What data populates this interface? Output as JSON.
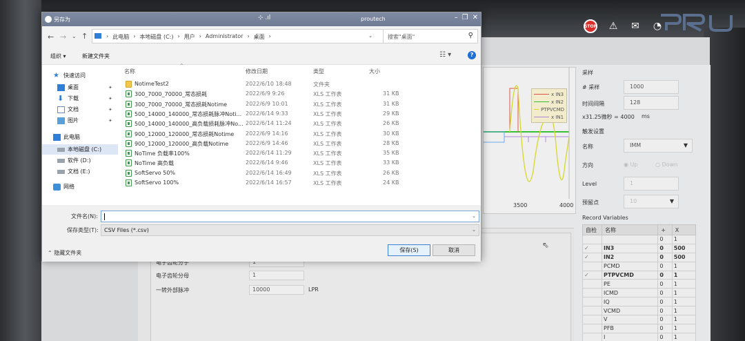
{
  "background": {
    "colors": {
      "stop": "#d9302c",
      "accent": "#1e6ed6"
    }
  },
  "app": {
    "plot": {
      "legend": [
        "x IN3",
        "x IN2",
        "PTPVCMD",
        "x IN1"
      ],
      "legend_colors": [
        "#e0504a",
        "#35c035",
        "#d8d832",
        "#b08ad8"
      ],
      "x_ticks": [
        "3500",
        "4000"
      ]
    },
    "sampling": {
      "section": "采样",
      "sample_label": "# 采样",
      "sample_value": "1000",
      "interval_label": "时间间隔",
      "interval_value": "128",
      "interval_note": "x31.25微秒 = 4000",
      "interval_unit": "ms"
    },
    "trigger": {
      "section": "触发设置",
      "name_label": "名称",
      "name_value": "IMM",
      "direction_label": "方向",
      "dir_up": "Up",
      "dir_down": "Down",
      "level_label": "Level",
      "level_value": "1",
      "pretrigger_label": "预留点",
      "pretrigger_value": "10"
    },
    "record_variables": {
      "title": "Record Variables",
      "headers": [
        "自检",
        "名称",
        "+",
        "X"
      ],
      "rows": [
        {
          "check": "",
          "name": "",
          "plus": "0",
          "x": "1",
          "style": ""
        },
        {
          "check": "✓",
          "name": "IN3",
          "plus": "0",
          "x": "500",
          "style": "rv-red"
        },
        {
          "check": "✓",
          "name": "IN2",
          "plus": "0",
          "x": "500",
          "style": "rv-green"
        },
        {
          "check": "",
          "name": "PCMD",
          "plus": "0",
          "x": "1",
          "style": ""
        },
        {
          "check": "✓",
          "name": "PTPVCMD",
          "plus": "0",
          "x": "1",
          "style": "rv-yellow"
        },
        {
          "check": "",
          "name": "PE",
          "plus": "0",
          "x": "1",
          "style": ""
        },
        {
          "check": "",
          "name": "ICMD",
          "plus": "0",
          "x": "1",
          "style": ""
        },
        {
          "check": "",
          "name": "IQ",
          "plus": "0",
          "x": "1",
          "style": ""
        },
        {
          "check": "",
          "name": "VCMD",
          "plus": "0",
          "x": "1",
          "style": ""
        },
        {
          "check": "",
          "name": "V",
          "plus": "0",
          "x": "1",
          "style": ""
        },
        {
          "check": "",
          "name": "PFB",
          "plus": "0",
          "x": "1",
          "style": ""
        },
        {
          "check": "",
          "name": "I",
          "plus": "0",
          "x": "1",
          "style": ""
        }
      ]
    },
    "gear": {
      "numerator_label": "电子齿轮分子",
      "numerator_value": "1",
      "denominator_label": "电子齿轮分母",
      "denominator_value": "1",
      "pulse_label": "一转外部脉冲",
      "pulse_value": "10000",
      "pulse_unit": "LPR"
    }
  },
  "dialog": {
    "title": "另存为",
    "center_title": "proutech",
    "address": {
      "crumbs": [
        "此电脑",
        "本地磁盘 (C:)",
        "用户",
        "Administrator",
        "桌面"
      ]
    },
    "search_placeholder": "搜索\"桌面\"",
    "toolbar": {
      "organize": "组织 ▾",
      "new_folder": "新建文件夹"
    },
    "nav": {
      "quick_access": "快速访问",
      "desktop": "桌面",
      "downloads": "下载",
      "documents": "文档",
      "pictures": "图片",
      "this_pc": "此电脑",
      "drive_c": "本地磁盘 (C:)",
      "drive_d": "软件 (D:)",
      "drive_e": "文档 (E:)",
      "network": "网络"
    },
    "columns": {
      "name": "名称",
      "date": "修改日期",
      "type": "类型",
      "size": "大小"
    },
    "files": [
      {
        "name": "NotimeTest2",
        "date": "2022/6/10 18:48",
        "type": "文件夹",
        "size": "",
        "kind": "folder"
      },
      {
        "name": "300_7000_70000_常态损耗",
        "date": "2022/6/9 9:26",
        "type": "XLS 工作表",
        "size": "31 KB",
        "kind": "xls"
      },
      {
        "name": "300_7000_70000_常态损耗Notime",
        "date": "2022/6/9 10:01",
        "type": "XLS 工作表",
        "size": "31 KB",
        "kind": "xls"
      },
      {
        "name": "500_14000_140000_常态损耗脉冲Noti...",
        "date": "2022/6/14 9:33",
        "type": "XLS 工作表",
        "size": "29 KB",
        "kind": "xls"
      },
      {
        "name": "500_14000_140000_高负载损耗脉冲No...",
        "date": "2022/6/14 11:24",
        "type": "XLS 工作表",
        "size": "26 KB",
        "kind": "xls"
      },
      {
        "name": "900_12000_120000_常态损耗Notime",
        "date": "2022/6/9 14:16",
        "type": "XLS 工作表",
        "size": "30 KB",
        "kind": "xls"
      },
      {
        "name": "900_12000_120000_高负载Notime",
        "date": "2022/6/9 14:46",
        "type": "XLS 工作表",
        "size": "28 KB",
        "kind": "xls"
      },
      {
        "name": "NoTime 负载率100%",
        "date": "2022/6/14 11:29",
        "type": "XLS 工作表",
        "size": "35 KB",
        "kind": "xls"
      },
      {
        "name": "NoTime 高负载",
        "date": "2022/6/14 9:46",
        "type": "XLS 工作表",
        "size": "33 KB",
        "kind": "xls"
      },
      {
        "name": "SoftServo 50%",
        "date": "2022/6/14 16:49",
        "type": "XLS 工作表",
        "size": "26 KB",
        "kind": "xls"
      },
      {
        "name": "SoftServo 100%",
        "date": "2022/6/14 16:57",
        "type": "XLS 工作表",
        "size": "24 KB",
        "kind": "xls"
      }
    ],
    "filename_label": "文件名(N):",
    "filename_value": "",
    "filetype_label": "保存类型(T):",
    "filetype_value": "CSV Files (*.csv)",
    "hide_folders": "隐藏文件夹",
    "save_button": "保存(S)",
    "cancel_button": "取消"
  }
}
